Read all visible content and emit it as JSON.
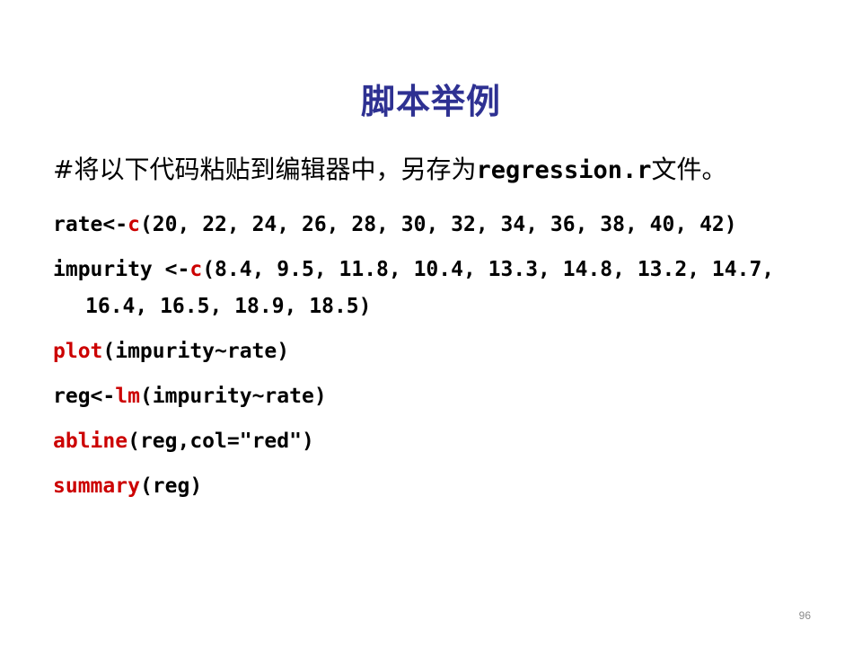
{
  "slide": {
    "title": "脚本举例",
    "intro": {
      "text": "#将以下代码粘贴到编辑器中，另存为",
      "filename": "regression.r",
      "text_end": "文件。"
    },
    "code_lines": [
      {
        "name": "code-line-rate",
        "parts": [
          {
            "text": "rate<-",
            "style": "plain"
          },
          {
            "text": "c",
            "style": "function"
          },
          {
            "text": "(20, 22, 24, 26, 28, 30, 32, 34, 36, 38, 40, 42)",
            "style": "plain"
          }
        ]
      },
      {
        "name": "code-line-impurity",
        "parts": [
          {
            "text": "impurity <-",
            "style": "plain"
          },
          {
            "text": "c",
            "style": "function"
          },
          {
            "text": "(8.4, 9.5, 11.8, 10.4, 13.3, 14.8, 13.2, 14.7, 16.4, 16.5, 18.9, 18.5)",
            "style": "plain"
          }
        ]
      },
      {
        "name": "code-line-plot",
        "parts": [
          {
            "text": "plot",
            "style": "function"
          },
          {
            "text": "(impurity~rate)",
            "style": "plain"
          }
        ]
      },
      {
        "name": "code-line-reg",
        "parts": [
          {
            "text": "reg<-",
            "style": "plain"
          },
          {
            "text": "lm",
            "style": "function"
          },
          {
            "text": "(impurity~rate)",
            "style": "plain"
          }
        ]
      },
      {
        "name": "code-line-abline",
        "parts": [
          {
            "text": "abline",
            "style": "function"
          },
          {
            "text": "(reg,col=\"red\")",
            "style": "plain"
          }
        ]
      },
      {
        "name": "code-line-summary",
        "parts": [
          {
            "text": "summary",
            "style": "function"
          },
          {
            "text": "(reg)",
            "style": "plain"
          }
        ]
      }
    ],
    "page_number": "96"
  },
  "colors": {
    "title": "#2e3192",
    "function": "#cc0000",
    "body_text": "#000000",
    "page_number": "#8c8c8c",
    "background": "#ffffff"
  }
}
